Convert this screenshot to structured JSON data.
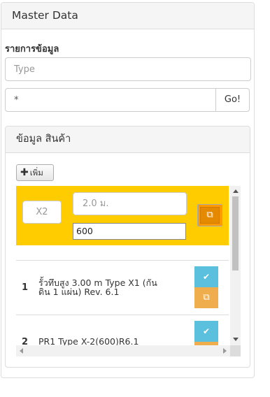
{
  "master_panel": {
    "title": "Master Data"
  },
  "list_label": "รายการข้อมูล",
  "type_input": {
    "placeholder": "Type",
    "value": ""
  },
  "search": {
    "value": "*",
    "go_label": "Go!"
  },
  "product_panel": {
    "title": "ข้อมูล สินค้า",
    "add_label": "เพิ่ม",
    "editor": {
      "qty": "X2",
      "size": "2.0 ม.",
      "length": "600",
      "highlight_color": "#ffcc00"
    },
    "items": [
      {
        "index": "1",
        "name_line1": "รั้วทึบสูง 3.00 m Type X1 (กัน",
        "name_line2": "ดิน 1 แผ่น) Rev. 6.1"
      },
      {
        "index": "2",
        "name_line1": "PR1 Type X-2(600)R6.1",
        "name_line2": ""
      }
    ]
  },
  "colors": {
    "check_button": "#5bc0de",
    "copy_button": "#f0ad4e"
  }
}
